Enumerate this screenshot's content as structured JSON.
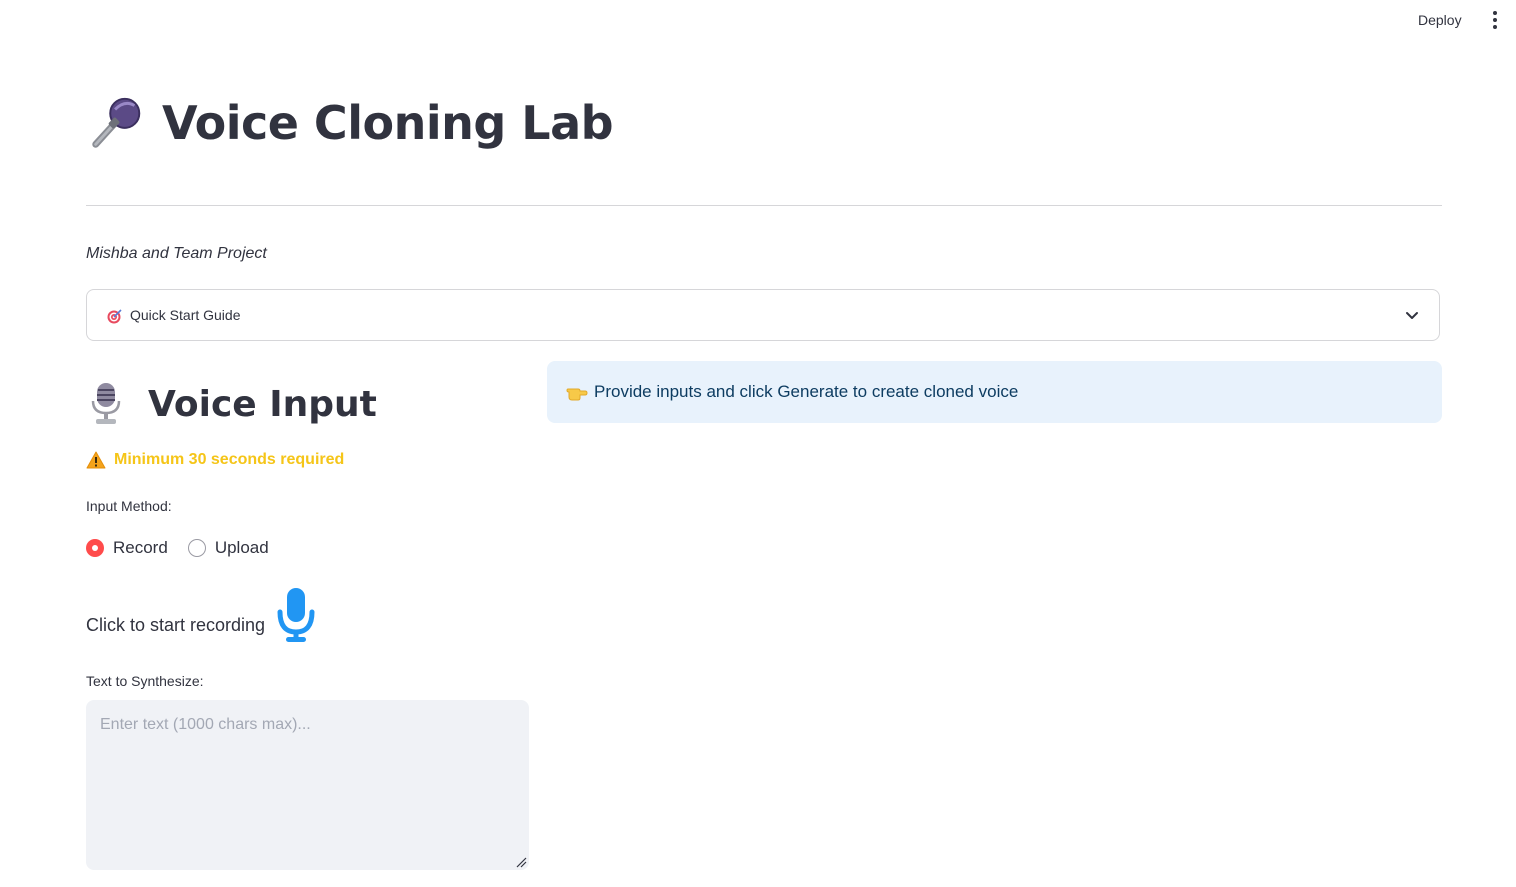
{
  "topbar": {
    "deploy_label": "Deploy",
    "menu_icon": "more-vertical-icon"
  },
  "header": {
    "title": "Voice Cloning Lab",
    "title_icon": "microphone-icon",
    "subtitle": "Mishba and Team Project"
  },
  "expander": {
    "label": "Quick Start Guide",
    "icon": "target-icon",
    "expanded": false
  },
  "voice_input": {
    "heading": "Voice Input",
    "heading_icon": "studio-microphone-icon",
    "warning": "Minimum 30 seconds required",
    "input_method_label": "Input Method:",
    "options": [
      "Record",
      "Upload"
    ],
    "selected": "Record",
    "record_prompt": "Click to start recording",
    "text_label": "Text to Synthesize:",
    "text_placeholder": "Enter text (1000 chars max)...",
    "text_value": ""
  },
  "info_box": {
    "icon": "pointing-hand-icon",
    "text": "Provide inputs and click Generate to create cloned voice"
  },
  "colors": {
    "accent": "#ff4b4b",
    "warning": "#f5c518",
    "info_bg": "#e8f2fc",
    "info_text": "#0d3c61",
    "mic_blue": "#2196f3"
  }
}
